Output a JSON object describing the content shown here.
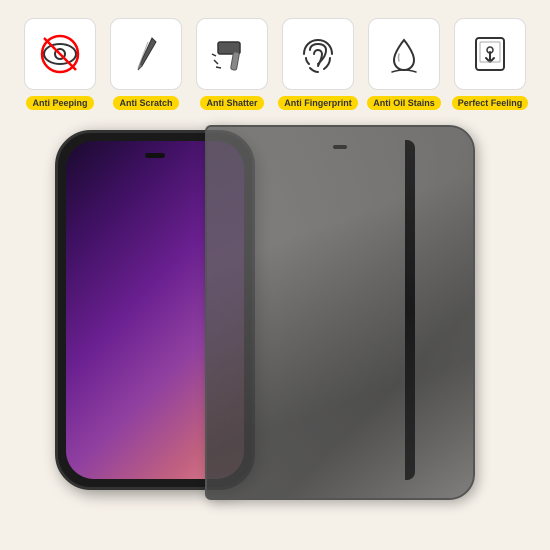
{
  "background_color": "#f5f0e8",
  "features": [
    {
      "id": "anti-peeping",
      "label": "Anti Peeping",
      "icon": "eye-slash"
    },
    {
      "id": "anti-scratch",
      "label": "Anti Scratch",
      "icon": "knife"
    },
    {
      "id": "anti-shatter",
      "label": "Anti Shatter",
      "icon": "hammer"
    },
    {
      "id": "anti-fingerprint",
      "label": "Anti Fingerprint",
      "icon": "fingerprint"
    },
    {
      "id": "anti-oil-stains",
      "label": "Anti Oil Stains",
      "icon": "water-drop"
    },
    {
      "id": "perfect-feeling",
      "label": "Perfect Feeling",
      "icon": "touch"
    }
  ]
}
